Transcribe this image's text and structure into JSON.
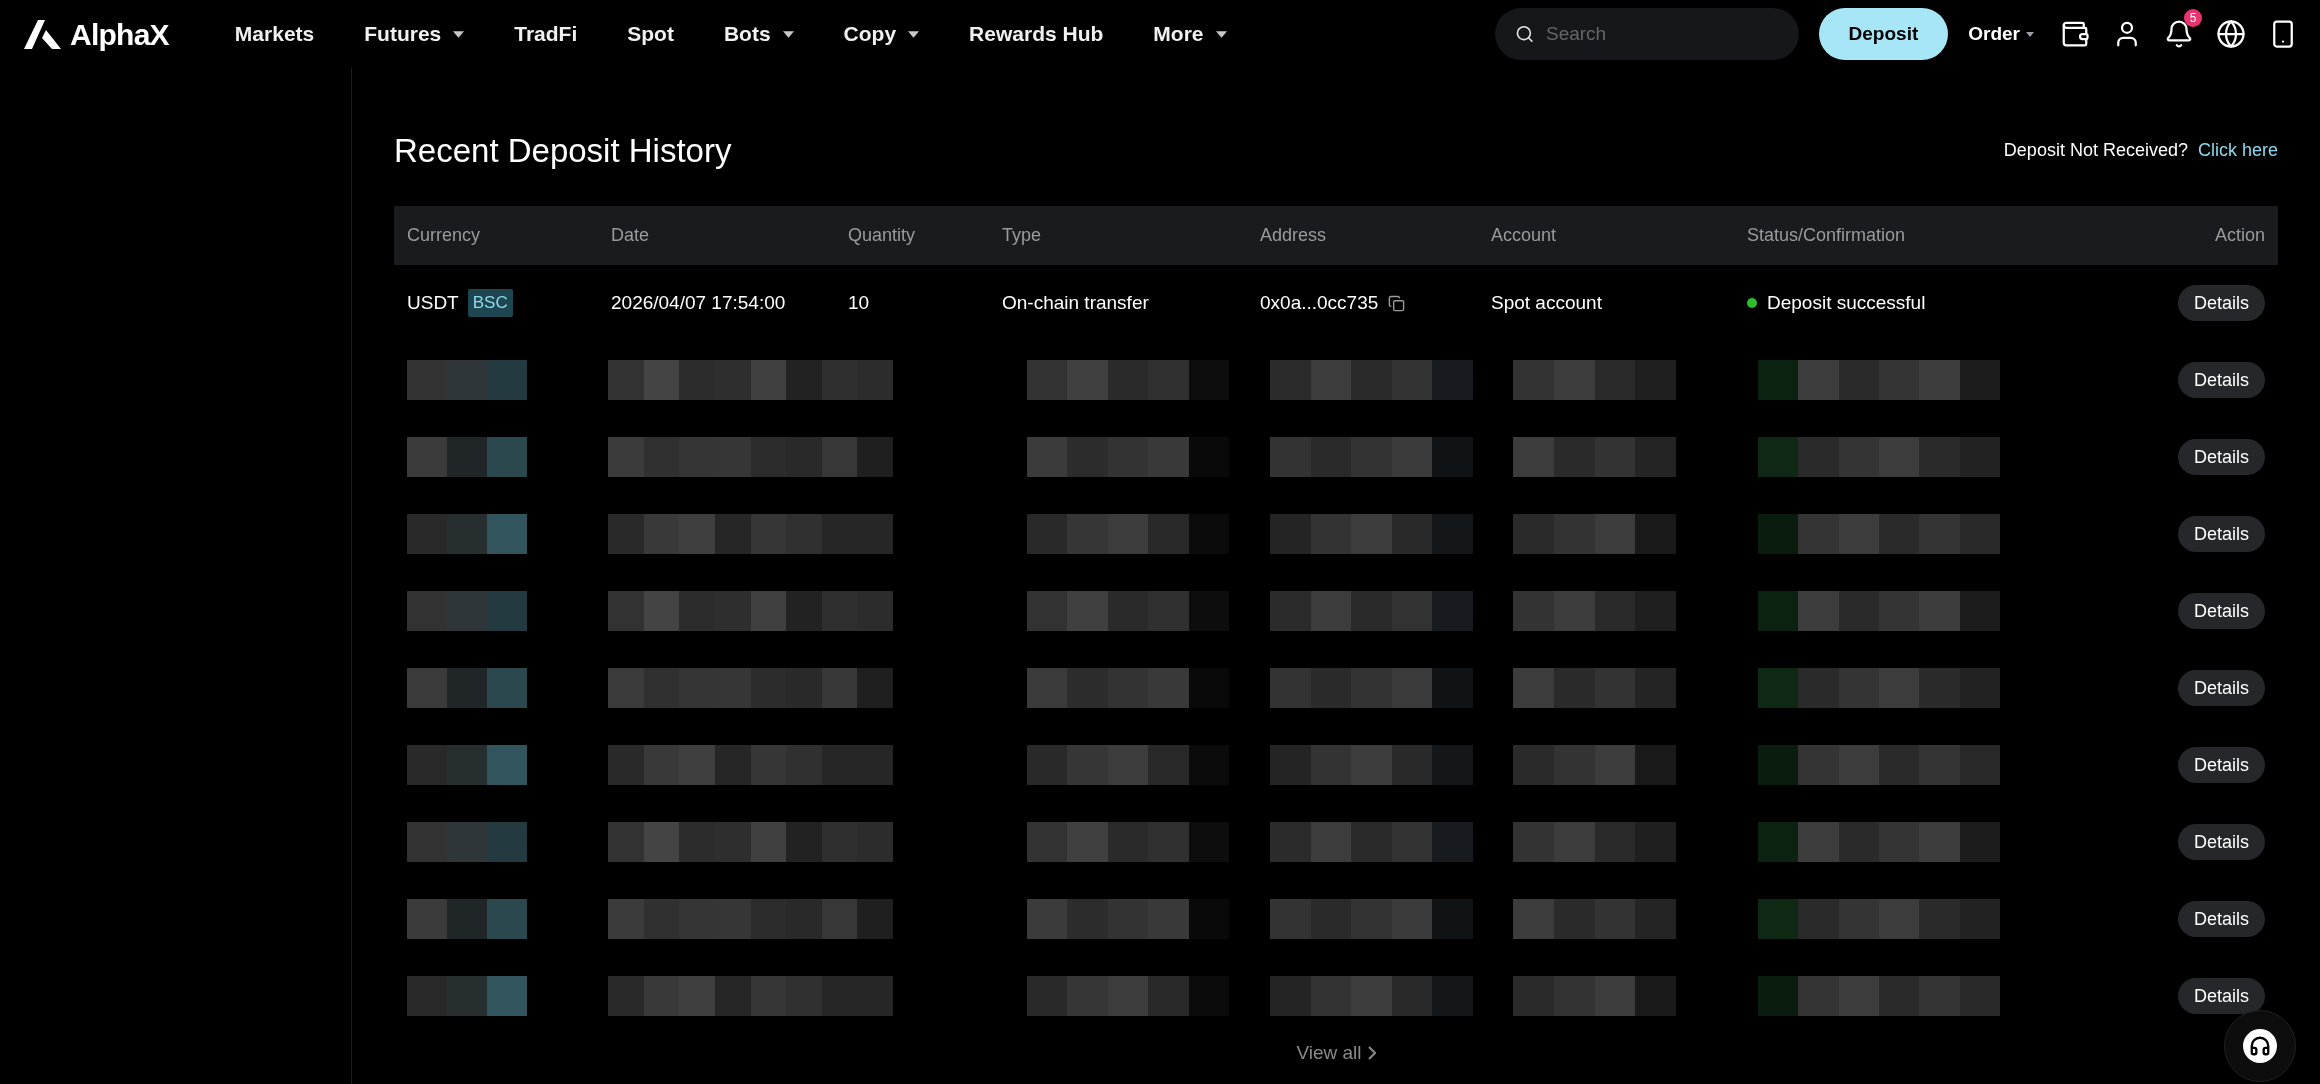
{
  "logo": {
    "text": "AlphaX"
  },
  "nav": [
    {
      "label": "Markets",
      "dropdown": false
    },
    {
      "label": "Futures",
      "dropdown": true
    },
    {
      "label": "TradFi",
      "dropdown": false
    },
    {
      "label": "Spot",
      "dropdown": false
    },
    {
      "label": "Bots",
      "dropdown": true
    },
    {
      "label": "Copy",
      "dropdown": true
    },
    {
      "label": "Rewards Hub",
      "dropdown": false
    },
    {
      "label": "More",
      "dropdown": true
    }
  ],
  "search": {
    "placeholder": "Search"
  },
  "deposit_button": "Deposit",
  "order_menu": "Order",
  "notifications": {
    "count": "5"
  },
  "title": "Recent Deposit History",
  "help": {
    "text": "Deposit Not Received?",
    "link": "Click here"
  },
  "table": {
    "columns": [
      "Currency",
      "Date",
      "Quantity",
      "Type",
      "Address",
      "Account",
      "Status/Confirmation",
      "Action"
    ],
    "rows": [
      {
        "kind": "entry",
        "currency": "USDT",
        "network": "BSC",
        "date": "2026/04/07 17:54:00",
        "quantity": "10",
        "type": "On-chain transfer",
        "address": "0x0a...0cc735",
        "account": "Spot account",
        "status": "Deposit successful",
        "color": "#2ebd2e",
        "action": "Details"
      },
      {
        "kind": "redacted",
        "action": "Details"
      },
      {
        "kind": "redacted",
        "action": "Details"
      },
      {
        "kind": "redacted",
        "action": "Details"
      },
      {
        "kind": "redacted",
        "action": "Details"
      },
      {
        "kind": "redacted",
        "action": "Details"
      },
      {
        "kind": "redacted",
        "action": "Details"
      },
      {
        "kind": "redacted",
        "action": "Details"
      },
      {
        "kind": "redacted",
        "action": "Details"
      },
      {
        "kind": "redacted",
        "action": "Details"
      }
    ]
  },
  "view_all": "View all"
}
